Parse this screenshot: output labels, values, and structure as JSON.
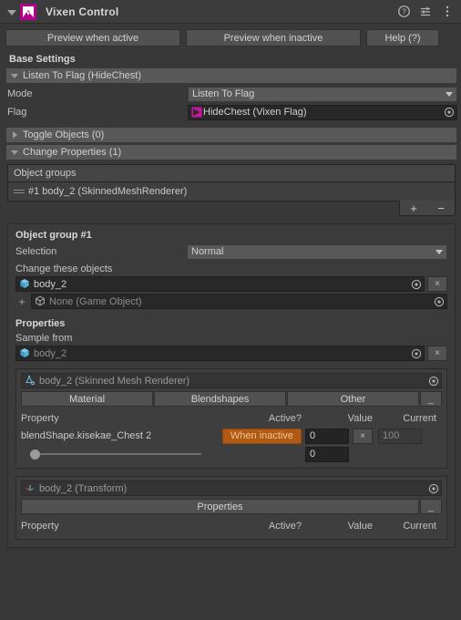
{
  "window": {
    "title": "Vixen Control",
    "logo_icon": "vixen-logo-icon",
    "header_icons": [
      "help-icon",
      "preset-icon",
      "more-menu-icon"
    ]
  },
  "toolbar": {
    "preview_active_label": "Preview when active",
    "preview_inactive_label": "Preview when inactive",
    "help_label": "Help (?)"
  },
  "base_settings": {
    "title": "Base Settings",
    "foldout_label": "Listen To Flag (HideChest)",
    "mode_label": "Mode",
    "mode_value": "Listen To Flag",
    "flag_label": "Flag",
    "flag_value": "HideChest (Vixen Flag)",
    "flag_icon": "vixen-flag-icon"
  },
  "sections": [
    {
      "label": "Toggle Objects (0)",
      "expanded": false
    },
    {
      "label": "Change Properties (1)",
      "expanded": true
    }
  ],
  "object_groups": {
    "header": "Object groups",
    "items": [
      {
        "label": "#1 body_2 (SkinnedMeshRenderer)",
        "handle_icon": "drag-handle-icon"
      }
    ],
    "add_label": "+",
    "remove_label": "−"
  },
  "group_panel": {
    "title": "Object group #1",
    "selection_label": "Selection",
    "selection_value": "Normal",
    "change_objects_label": "Change these objects",
    "objects": [
      {
        "name": "body_2",
        "icon": "game-object-icon",
        "has_clear": true,
        "placeholder": false
      },
      {
        "name": "None (Game Object)",
        "icon": "game-object-outline-icon",
        "has_clear": false,
        "placeholder": true
      }
    ],
    "add_object_label": "+",
    "clear_label": "×",
    "properties_label": "Properties",
    "sample_from_label": "Sample from",
    "sample_from_value": "body_2",
    "sample_from_icon": "game-object-icon"
  },
  "components": [
    {
      "name": "body_2 (Skinned Mesh Renderer)",
      "icon": "skinned-mesh-renderer-icon",
      "tabs": [
        "Material",
        "Blendshapes",
        "Other"
      ],
      "minimize_label": "_",
      "columns": [
        "Property",
        "Active?",
        "Value",
        "Current"
      ],
      "rows": [
        {
          "property": "blendShape.kisekae_Chest 2",
          "active_state": "When inactive",
          "value": "0",
          "clear_label": "×",
          "current": "100",
          "slider_value": "0",
          "slider_percent": 0
        }
      ]
    },
    {
      "name": "body_2 (Transform)",
      "icon": "transform-icon",
      "button_label": "Properties",
      "minimize_label": "_",
      "columns": [
        "Property",
        "Active?",
        "Value",
        "Current"
      ],
      "rows": []
    }
  ],
  "colors": {
    "background": "#383838",
    "panel": "#3b3b3b",
    "accent_magenta": "#b5008f",
    "accent_orange": "#b05a16",
    "field_dark": "#282828",
    "button": "#515151"
  }
}
